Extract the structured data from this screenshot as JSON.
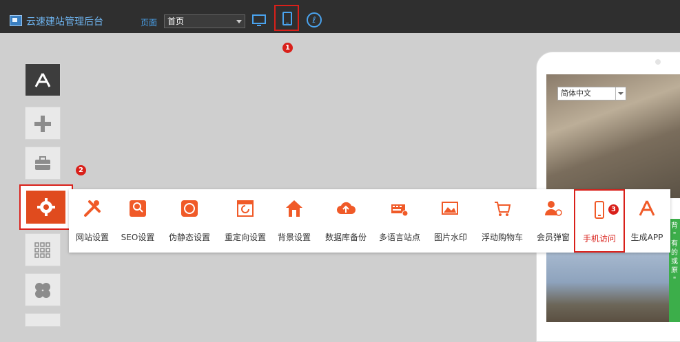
{
  "app": {
    "title": "云速建站管理后台"
  },
  "header": {
    "page_label": "页面",
    "page_select_value": "首页",
    "icons": [
      "desktop-icon",
      "mobile-icon",
      "miniprogram-icon"
    ]
  },
  "badges": {
    "one": "1",
    "two": "2",
    "three": "3"
  },
  "settings": [
    {
      "label": "网站设置"
    },
    {
      "label": "SEO设置"
    },
    {
      "label": "伪静态设置"
    },
    {
      "label": "重定向设置"
    },
    {
      "label": "背景设置"
    },
    {
      "label": "数据库备份"
    },
    {
      "label": "多语言站点"
    },
    {
      "label": "图片水印"
    },
    {
      "label": "浮动购物车"
    },
    {
      "label": "会员弹窗"
    },
    {
      "label": "手机访问"
    },
    {
      "label": "生成APP"
    }
  ],
  "preview": {
    "language": "简体中文",
    "green_text": "背 \" 有 的 或 原 \""
  },
  "colors": {
    "topbar": "#2f2f2f",
    "accent_blue": "#4aa3ee",
    "highlight_red": "#d9201a",
    "settings_orange": "#e04b1e",
    "icon_orange": "#f05a28"
  }
}
